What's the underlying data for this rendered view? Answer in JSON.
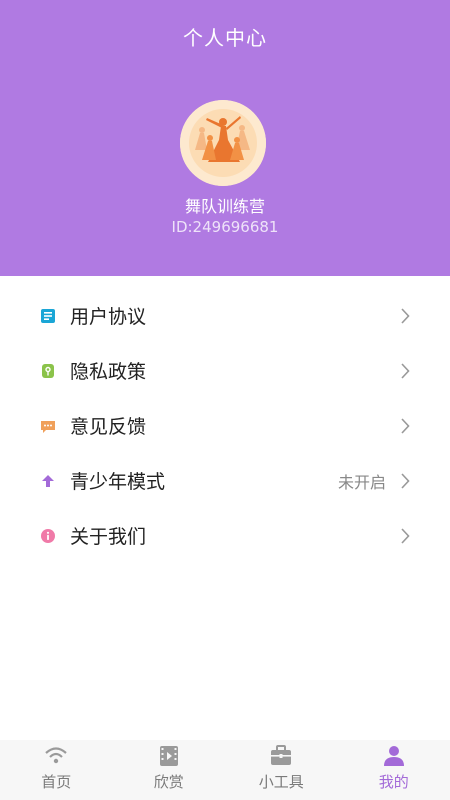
{
  "header": {
    "title": "个人中心",
    "username": "舞队训练营",
    "user_id": "ID:249696681",
    "background_color": "#b07ae2"
  },
  "menu": {
    "items": [
      {
        "label": "用户协议",
        "icon": "document-icon",
        "icon_color": "#1aa6d6",
        "value": ""
      },
      {
        "label": "隐私政策",
        "icon": "privacy-lock-icon",
        "icon_color": "#8bc34a",
        "value": ""
      },
      {
        "label": "意见反馈",
        "icon": "message-icon",
        "icon_color": "#f0a05a",
        "value": ""
      },
      {
        "label": "青少年模式",
        "icon": "teen-mode-arrow-icon",
        "icon_color": "#a36ad8",
        "value": "未开启"
      },
      {
        "label": "关于我们",
        "icon": "info-icon",
        "icon_color": "#f07aa8",
        "value": ""
      }
    ]
  },
  "tabbar": {
    "tabs": [
      {
        "label": "首页",
        "icon": "wifi-icon",
        "active": false
      },
      {
        "label": "欣赏",
        "icon": "video-icon",
        "active": false
      },
      {
        "label": "小工具",
        "icon": "toolbox-icon",
        "active": false
      },
      {
        "label": "我的",
        "icon": "user-icon",
        "active": true
      }
    ],
    "active_color": "#a36ad8",
    "inactive_color": "#7a7a7a"
  }
}
